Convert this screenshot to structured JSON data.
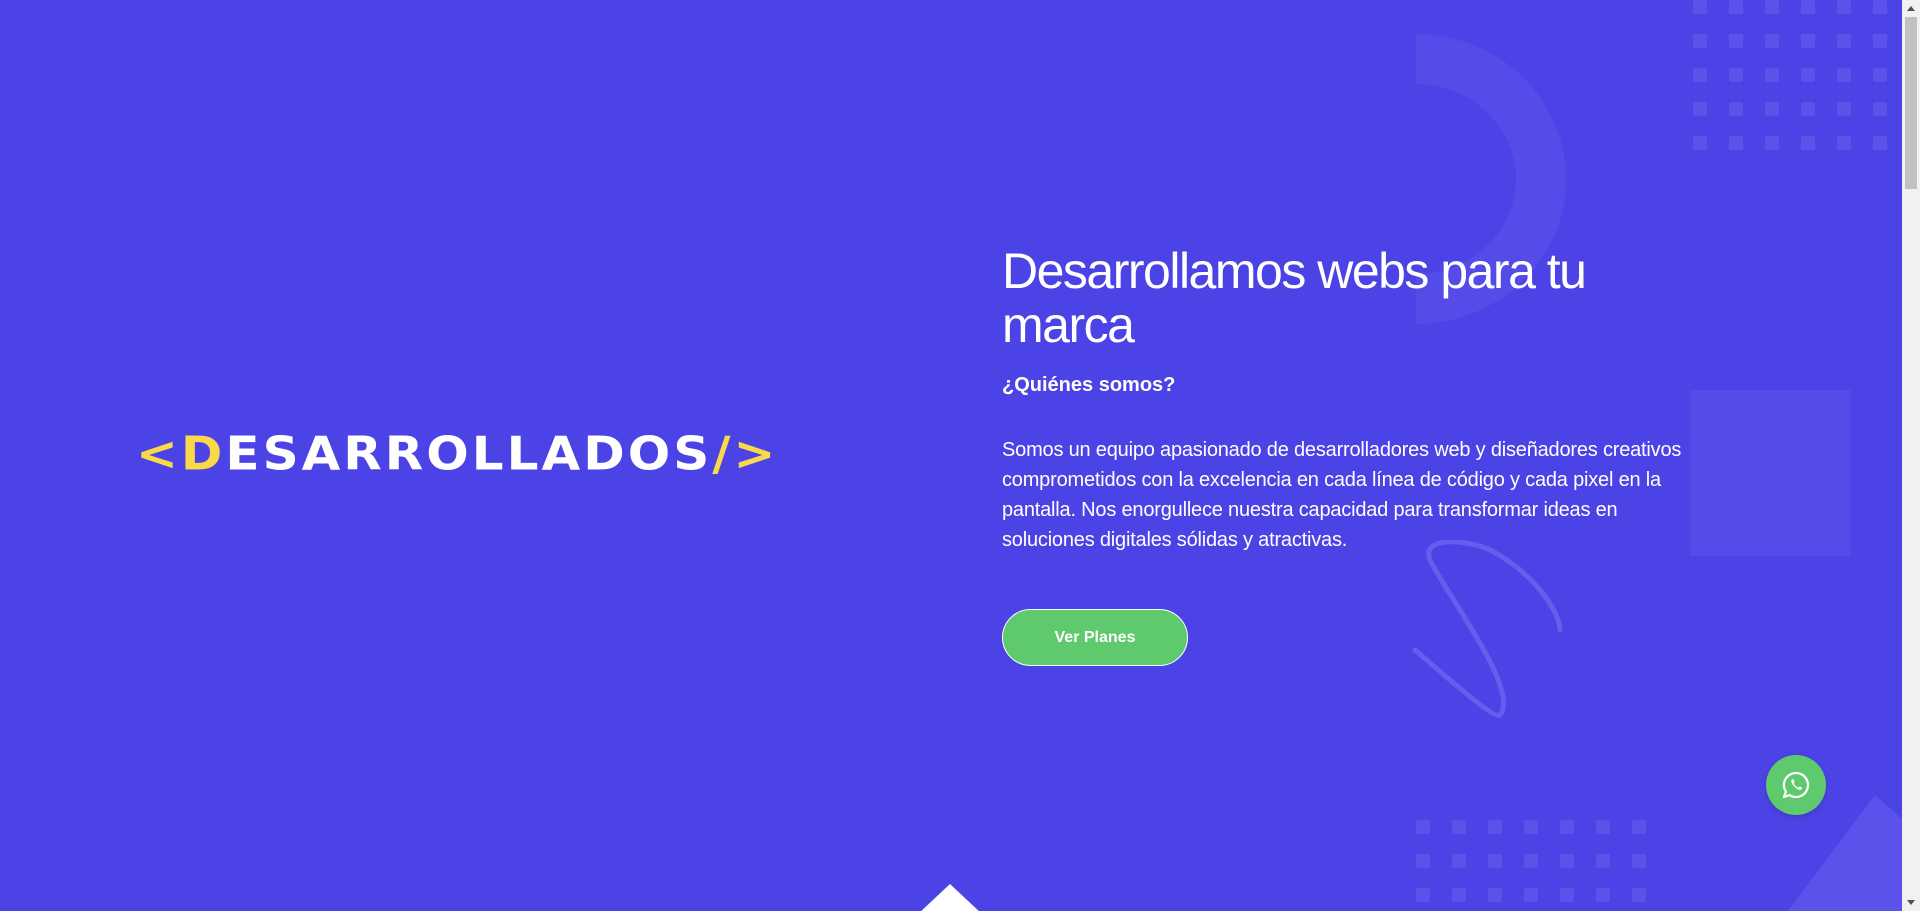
{
  "logo": {
    "open_bracket": "<",
    "first_letter": "D",
    "rest": "ESARROLLADOS",
    "close_slash": "/",
    "close_bracket": ">"
  },
  "hero": {
    "title": "Desarrollamos webs para tu marca",
    "subtitle": "¿Quiénes somos?",
    "description": "Somos un equipo apasionado de desarrolladores web y diseñadores creativos comprometidos con la excelencia en cada línea de código y cada pixel en la pantalla. Nos enorgullece nuestra capacidad para transformar ideas en soluciones digitales sólidas y atractivas.",
    "cta_label": "Ver Planes"
  },
  "icons": {
    "whatsapp": "whatsapp-icon",
    "scroll_up": "chevron-up-icon",
    "scroll_down": "chevron-down-icon"
  },
  "colors": {
    "background": "#4b43e5",
    "accent_yellow": "#f9d84a",
    "button_green": "#5fc96d",
    "text": "#ffffff"
  }
}
